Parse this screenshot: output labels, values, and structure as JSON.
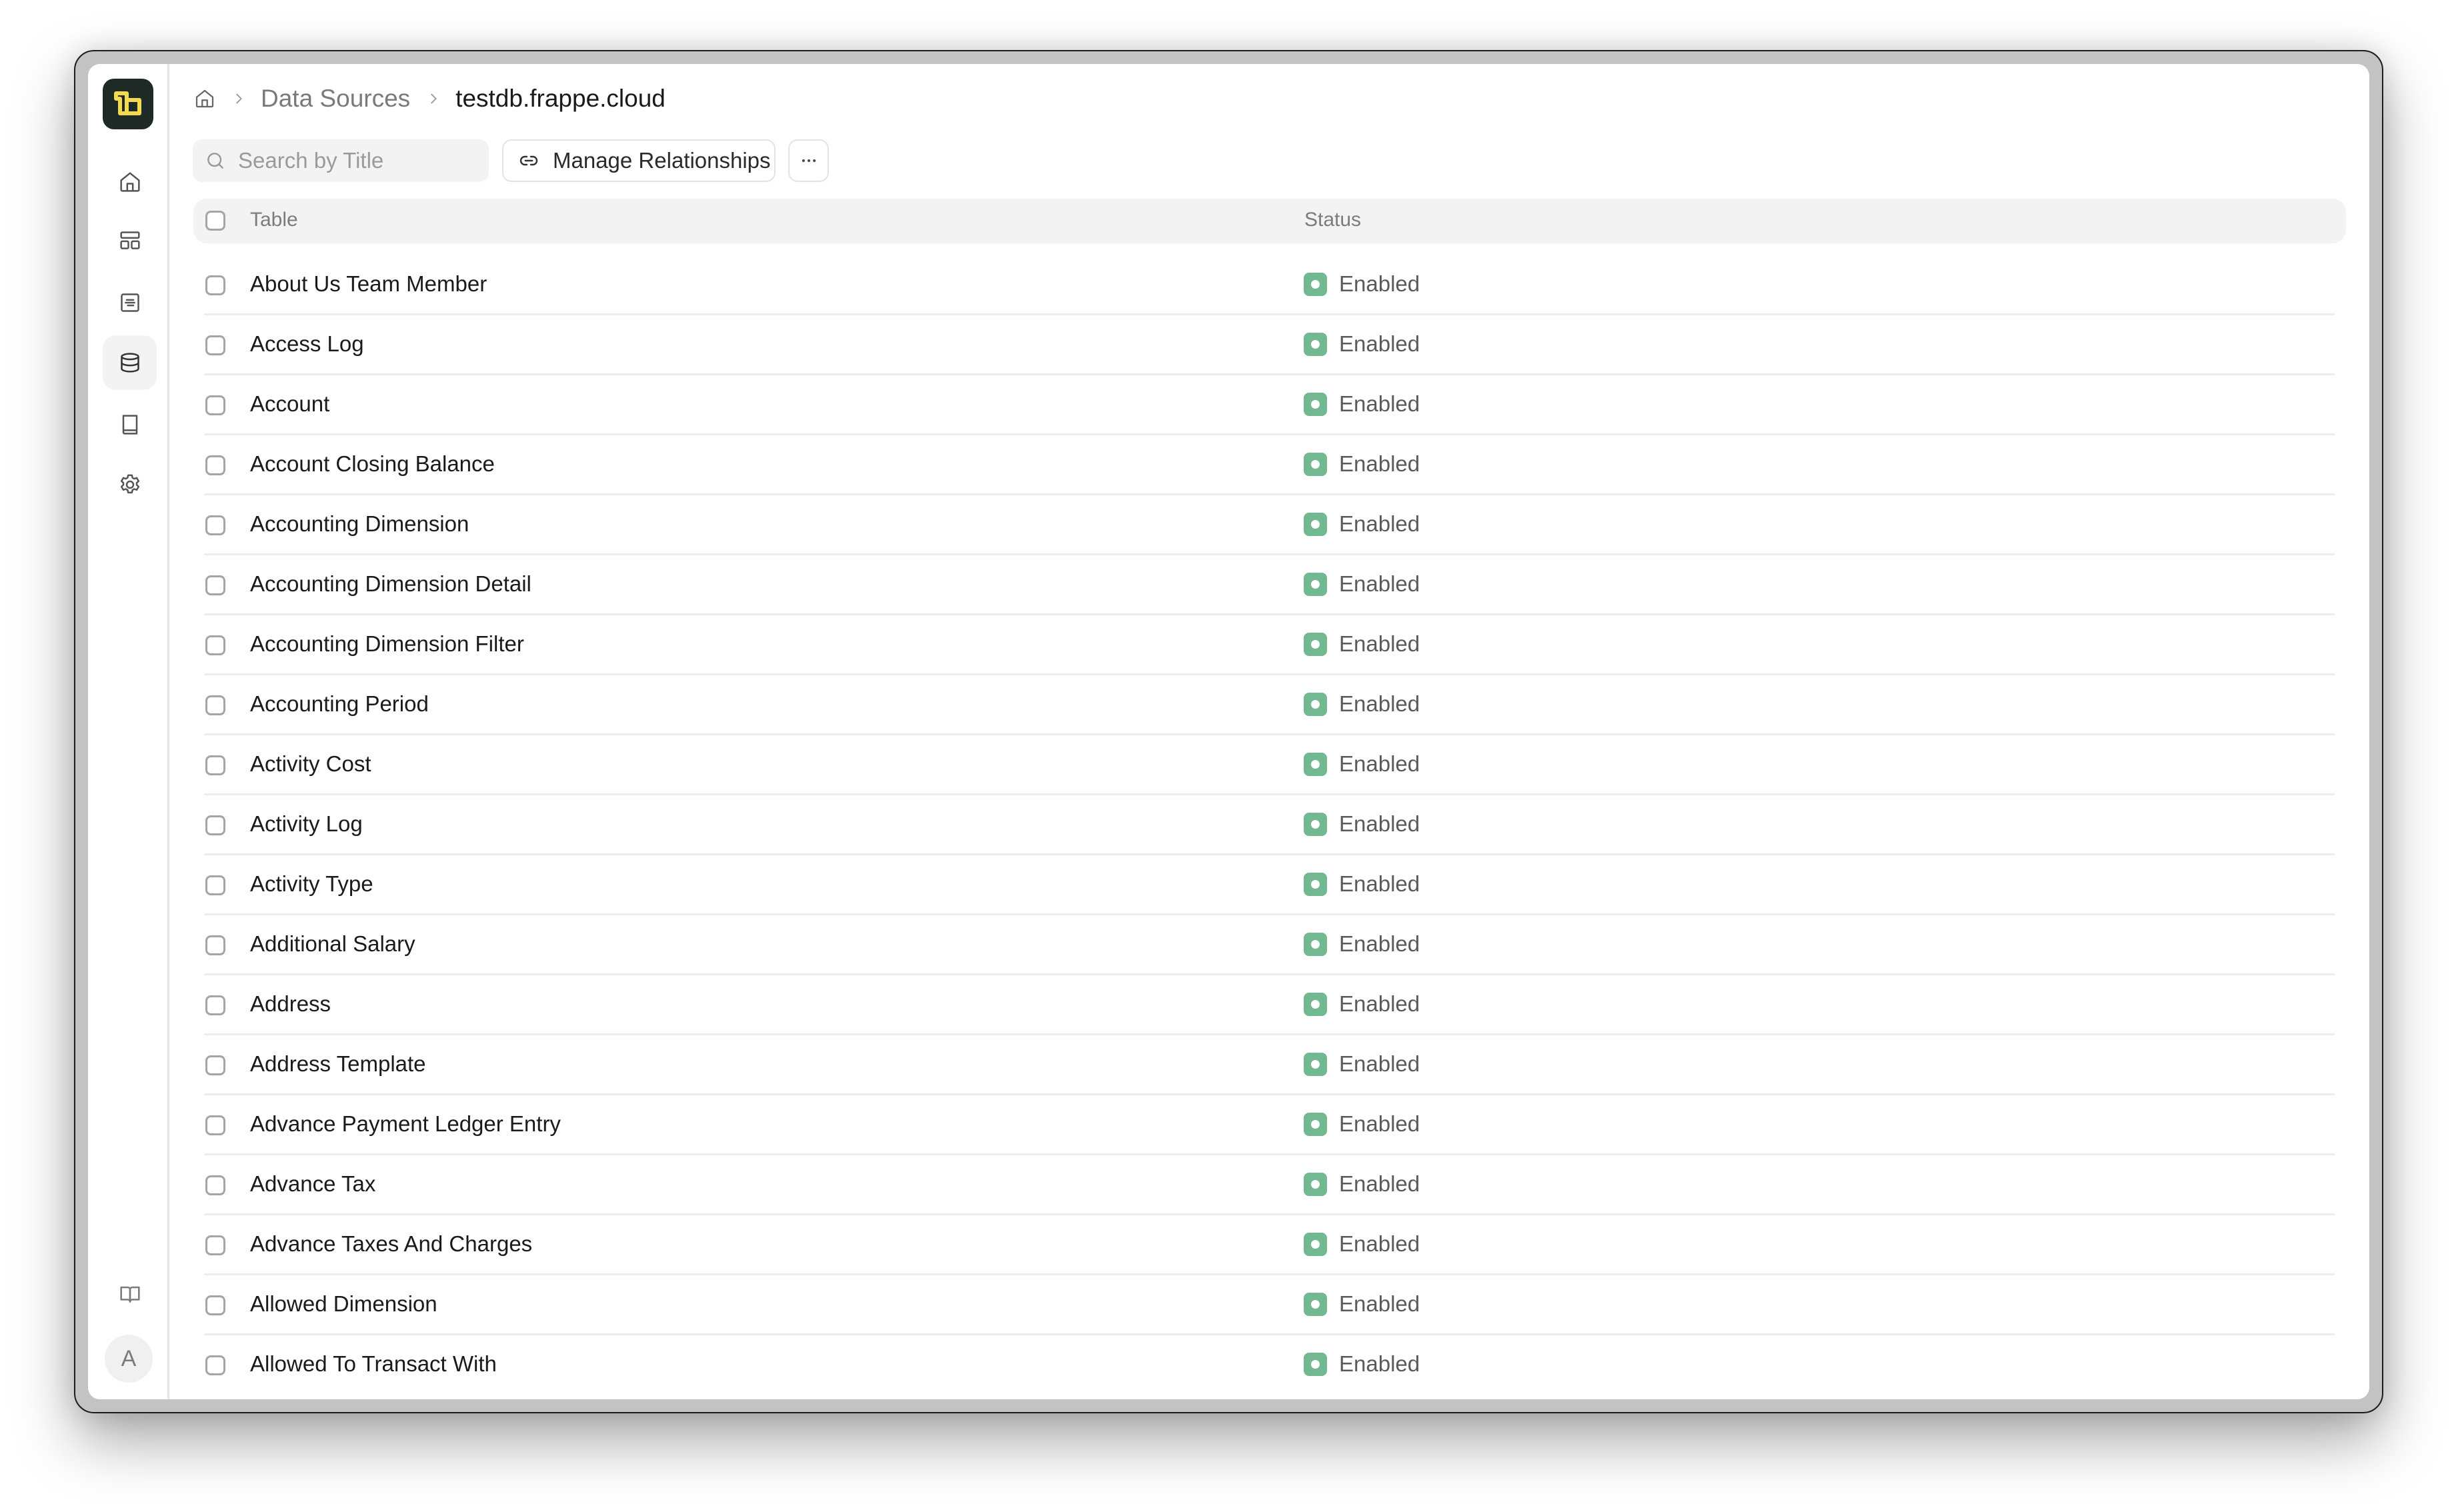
{
  "app": {
    "logo": "insights-logo",
    "sidebar": {
      "items": [
        {
          "name": "home",
          "icon": "home-icon",
          "active": false
        },
        {
          "name": "dashboards",
          "icon": "dashboard-icon",
          "active": false
        },
        {
          "name": "queries",
          "icon": "notebook-icon",
          "active": false
        },
        {
          "name": "data-sources",
          "icon": "database-icon",
          "active": true
        },
        {
          "name": "notebooks",
          "icon": "book-icon",
          "active": false
        },
        {
          "name": "settings",
          "icon": "gear-icon",
          "active": false
        }
      ],
      "bottom": {
        "help_icon": "open-book-icon",
        "avatar_initial": "A"
      }
    }
  },
  "breadcrumb": {
    "home_icon": "home-icon",
    "items": [
      "Data Sources",
      "testdb.frappe.cloud"
    ]
  },
  "toolbar": {
    "search_placeholder": "Search by Title",
    "search_value": "",
    "manage_label": "Manage Relationships",
    "more_icon": "ellipsis-icon"
  },
  "table": {
    "columns": [
      "Table",
      "Status"
    ],
    "status_color": "#72b890",
    "rows": [
      {
        "name": "About Us Team Member",
        "status": "Enabled"
      },
      {
        "name": "Access Log",
        "status": "Enabled"
      },
      {
        "name": "Account",
        "status": "Enabled"
      },
      {
        "name": "Account Closing Balance",
        "status": "Enabled"
      },
      {
        "name": "Accounting Dimension",
        "status": "Enabled"
      },
      {
        "name": "Accounting Dimension Detail",
        "status": "Enabled"
      },
      {
        "name": "Accounting Dimension Filter",
        "status": "Enabled"
      },
      {
        "name": "Accounting Period",
        "status": "Enabled"
      },
      {
        "name": "Activity Cost",
        "status": "Enabled"
      },
      {
        "name": "Activity Log",
        "status": "Enabled"
      },
      {
        "name": "Activity Type",
        "status": "Enabled"
      },
      {
        "name": "Additional Salary",
        "status": "Enabled"
      },
      {
        "name": "Address",
        "status": "Enabled"
      },
      {
        "name": "Address Template",
        "status": "Enabled"
      },
      {
        "name": "Advance Payment Ledger Entry",
        "status": "Enabled"
      },
      {
        "name": "Advance Tax",
        "status": "Enabled"
      },
      {
        "name": "Advance Taxes And Charges",
        "status": "Enabled"
      },
      {
        "name": "Allowed Dimension",
        "status": "Enabled"
      },
      {
        "name": "Allowed To Transact With",
        "status": "Enabled"
      }
    ]
  }
}
